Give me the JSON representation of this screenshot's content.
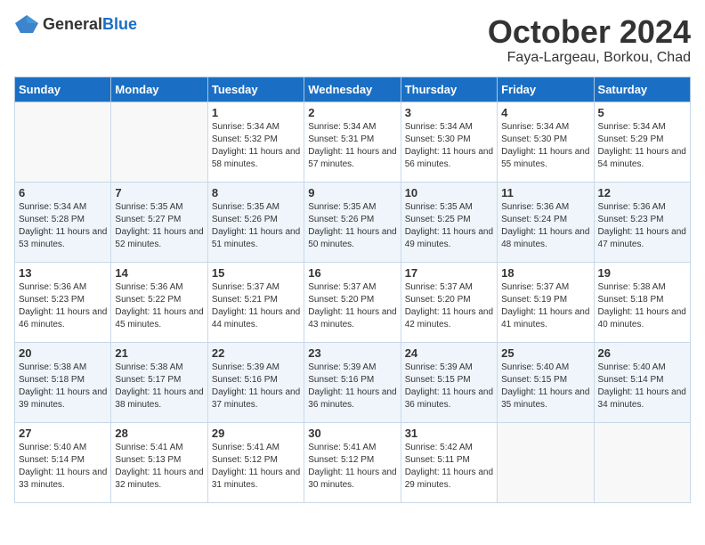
{
  "header": {
    "logo_general": "General",
    "logo_blue": "Blue",
    "month": "October 2024",
    "location": "Faya-Largeau, Borkou, Chad"
  },
  "weekdays": [
    "Sunday",
    "Monday",
    "Tuesday",
    "Wednesday",
    "Thursday",
    "Friday",
    "Saturday"
  ],
  "weeks": [
    [
      {
        "day": "",
        "content": ""
      },
      {
        "day": "",
        "content": ""
      },
      {
        "day": "1",
        "content": "Sunrise: 5:34 AM\nSunset: 5:32 PM\nDaylight: 11 hours and 58 minutes."
      },
      {
        "day": "2",
        "content": "Sunrise: 5:34 AM\nSunset: 5:31 PM\nDaylight: 11 hours and 57 minutes."
      },
      {
        "day": "3",
        "content": "Sunrise: 5:34 AM\nSunset: 5:30 PM\nDaylight: 11 hours and 56 minutes."
      },
      {
        "day": "4",
        "content": "Sunrise: 5:34 AM\nSunset: 5:30 PM\nDaylight: 11 hours and 55 minutes."
      },
      {
        "day": "5",
        "content": "Sunrise: 5:34 AM\nSunset: 5:29 PM\nDaylight: 11 hours and 54 minutes."
      }
    ],
    [
      {
        "day": "6",
        "content": "Sunrise: 5:34 AM\nSunset: 5:28 PM\nDaylight: 11 hours and 53 minutes."
      },
      {
        "day": "7",
        "content": "Sunrise: 5:35 AM\nSunset: 5:27 PM\nDaylight: 11 hours and 52 minutes."
      },
      {
        "day": "8",
        "content": "Sunrise: 5:35 AM\nSunset: 5:26 PM\nDaylight: 11 hours and 51 minutes."
      },
      {
        "day": "9",
        "content": "Sunrise: 5:35 AM\nSunset: 5:26 PM\nDaylight: 11 hours and 50 minutes."
      },
      {
        "day": "10",
        "content": "Sunrise: 5:35 AM\nSunset: 5:25 PM\nDaylight: 11 hours and 49 minutes."
      },
      {
        "day": "11",
        "content": "Sunrise: 5:36 AM\nSunset: 5:24 PM\nDaylight: 11 hours and 48 minutes."
      },
      {
        "day": "12",
        "content": "Sunrise: 5:36 AM\nSunset: 5:23 PM\nDaylight: 11 hours and 47 minutes."
      }
    ],
    [
      {
        "day": "13",
        "content": "Sunrise: 5:36 AM\nSunset: 5:23 PM\nDaylight: 11 hours and 46 minutes."
      },
      {
        "day": "14",
        "content": "Sunrise: 5:36 AM\nSunset: 5:22 PM\nDaylight: 11 hours and 45 minutes."
      },
      {
        "day": "15",
        "content": "Sunrise: 5:37 AM\nSunset: 5:21 PM\nDaylight: 11 hours and 44 minutes."
      },
      {
        "day": "16",
        "content": "Sunrise: 5:37 AM\nSunset: 5:20 PM\nDaylight: 11 hours and 43 minutes."
      },
      {
        "day": "17",
        "content": "Sunrise: 5:37 AM\nSunset: 5:20 PM\nDaylight: 11 hours and 42 minutes."
      },
      {
        "day": "18",
        "content": "Sunrise: 5:37 AM\nSunset: 5:19 PM\nDaylight: 11 hours and 41 minutes."
      },
      {
        "day": "19",
        "content": "Sunrise: 5:38 AM\nSunset: 5:18 PM\nDaylight: 11 hours and 40 minutes."
      }
    ],
    [
      {
        "day": "20",
        "content": "Sunrise: 5:38 AM\nSunset: 5:18 PM\nDaylight: 11 hours and 39 minutes."
      },
      {
        "day": "21",
        "content": "Sunrise: 5:38 AM\nSunset: 5:17 PM\nDaylight: 11 hours and 38 minutes."
      },
      {
        "day": "22",
        "content": "Sunrise: 5:39 AM\nSunset: 5:16 PM\nDaylight: 11 hours and 37 minutes."
      },
      {
        "day": "23",
        "content": "Sunrise: 5:39 AM\nSunset: 5:16 PM\nDaylight: 11 hours and 36 minutes."
      },
      {
        "day": "24",
        "content": "Sunrise: 5:39 AM\nSunset: 5:15 PM\nDaylight: 11 hours and 36 minutes."
      },
      {
        "day": "25",
        "content": "Sunrise: 5:40 AM\nSunset: 5:15 PM\nDaylight: 11 hours and 35 minutes."
      },
      {
        "day": "26",
        "content": "Sunrise: 5:40 AM\nSunset: 5:14 PM\nDaylight: 11 hours and 34 minutes."
      }
    ],
    [
      {
        "day": "27",
        "content": "Sunrise: 5:40 AM\nSunset: 5:14 PM\nDaylight: 11 hours and 33 minutes."
      },
      {
        "day": "28",
        "content": "Sunrise: 5:41 AM\nSunset: 5:13 PM\nDaylight: 11 hours and 32 minutes."
      },
      {
        "day": "29",
        "content": "Sunrise: 5:41 AM\nSunset: 5:12 PM\nDaylight: 11 hours and 31 minutes."
      },
      {
        "day": "30",
        "content": "Sunrise: 5:41 AM\nSunset: 5:12 PM\nDaylight: 11 hours and 30 minutes."
      },
      {
        "day": "31",
        "content": "Sunrise: 5:42 AM\nSunset: 5:11 PM\nDaylight: 11 hours and 29 minutes."
      },
      {
        "day": "",
        "content": ""
      },
      {
        "day": "",
        "content": ""
      }
    ]
  ]
}
